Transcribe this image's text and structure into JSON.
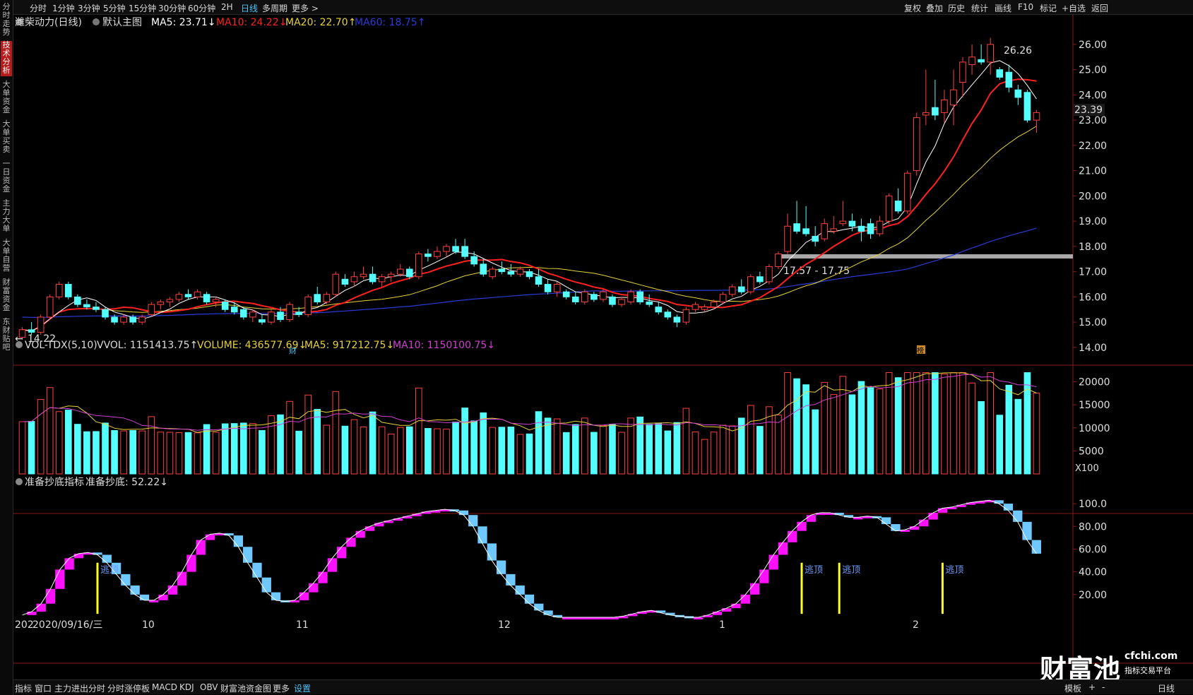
{
  "topbar": {
    "left_tabs": [
      "分时",
      "1分钟",
      "3分钟",
      "5分钟",
      "15分钟",
      "30分钟",
      "60分钟",
      "2H",
      "日线",
      "多周期",
      "更多 >"
    ],
    "active_tab": "日线",
    "right_items": [
      "复权",
      "叠加",
      "历史",
      "统计",
      "画线",
      "F10",
      "标记",
      "+自选",
      "返回"
    ]
  },
  "sidebar": {
    "items": [
      "分时走势",
      "技术分析",
      "大单资金",
      "大单买卖",
      "一日资金",
      "主力大单",
      "大单自营",
      "财富资金",
      "东财贴吧"
    ],
    "active": "技术分析"
  },
  "header": {
    "stock": "潍柴动力(日线)",
    "template": "默认主图",
    "ma5": "MA5: 23.71↓",
    "ma10": "MA10: 24.22↓",
    "ma20": "MA20: 22.70↑",
    "ma60": "MA60: 18.75↑",
    "colors": {
      "ma5": "#ffffff",
      "ma10": "#ff2020",
      "ma20": "#e6d23a",
      "ma60": "#2b3bd9"
    }
  },
  "price_panel": {
    "y_ticks": [
      "26.00",
      "25.00",
      "24.00",
      "23.00",
      "22.00",
      "21.00",
      "20.00",
      "19.00",
      "18.00",
      "17.00",
      "16.00",
      "15.00",
      "14.00"
    ],
    "high_label": "26.26",
    "low_label": "14.22",
    "current_label": "23.39",
    "zone_label": "17.57 - 17.75",
    "markers": [
      "财",
      "榜"
    ]
  },
  "volume_panel": {
    "header": {
      "name": "VOL-TDX(5,10)",
      "vvol": "VVOL: 1151413.75↑",
      "volume": "VOLUME: 436577.69↓",
      "ma5": "MA5: 917212.75↓",
      "ma10": "MA10: 1150100.75↓"
    },
    "y_ticks": [
      "20000",
      "15000",
      "10000",
      "5000"
    ],
    "unit": "X100"
  },
  "indicator_panel": {
    "header": {
      "name": "准备抄底指标",
      "value": "准备抄底: 52.22↓"
    },
    "y_ticks": [
      "100.0",
      "80.00",
      "60.00",
      "40.00",
      "20.00"
    ],
    "signal_label": "逃顶"
  },
  "x_axis": {
    "first_date": "2020/09/16/三",
    "first_prefix": "202",
    "months": [
      "10",
      "11",
      "12",
      "1",
      "2"
    ]
  },
  "bottombar": {
    "tabs": [
      "指标",
      "窗口",
      "主力进出分时",
      "分时涨停板",
      "MACD",
      "KDJ",
      "OBV",
      "财富池资金图",
      "更多",
      "设置"
    ],
    "active": "设置",
    "right_items": [
      "模板",
      "+",
      "-",
      "日线"
    ]
  },
  "watermark": {
    "brand": "财富池",
    "site": "cfchi.com",
    "slogan": "指标交易平台"
  },
  "chart_data": {
    "type": "candlestick",
    "y_range": [
      13.8,
      26.5
    ],
    "n_candles": 100,
    "ohlc": [
      [
        14.4,
        14.8,
        14.3,
        14.7
      ],
      [
        14.7,
        15.0,
        14.5,
        14.6
      ],
      [
        14.6,
        15.3,
        14.5,
        15.2
      ],
      [
        15.2,
        16.1,
        15.1,
        16.0
      ],
      [
        16.0,
        16.6,
        15.9,
        16.5
      ],
      [
        16.5,
        16.6,
        15.9,
        16.0
      ],
      [
        16.0,
        16.1,
        15.6,
        15.7
      ],
      [
        15.7,
        15.9,
        15.5,
        15.6
      ],
      [
        15.6,
        15.8,
        15.4,
        15.5
      ],
      [
        15.5,
        15.6,
        15.1,
        15.2
      ],
      [
        15.2,
        15.3,
        14.9,
        15.0
      ],
      [
        15.0,
        15.3,
        14.9,
        15.2
      ],
      [
        15.2,
        15.3,
        14.9,
        15.0
      ],
      [
        15.0,
        15.3,
        14.9,
        15.2
      ],
      [
        15.3,
        15.8,
        15.2,
        15.7
      ],
      [
        15.7,
        15.9,
        15.5,
        15.8
      ],
      [
        15.8,
        16.0,
        15.6,
        15.9
      ],
      [
        15.9,
        16.2,
        15.8,
        16.1
      ],
      [
        16.1,
        16.3,
        15.9,
        16.0
      ],
      [
        16.0,
        16.3,
        15.9,
        16.2
      ],
      [
        16.1,
        16.2,
        15.7,
        15.8
      ],
      [
        15.8,
        16.0,
        15.6,
        15.9
      ],
      [
        15.8,
        15.9,
        15.4,
        15.5
      ],
      [
        15.6,
        15.8,
        15.3,
        15.4
      ],
      [
        15.5,
        15.6,
        15.1,
        15.2
      ],
      [
        15.2,
        15.5,
        15.0,
        15.4
      ],
      [
        15.1,
        15.3,
        14.9,
        15.0
      ],
      [
        15.0,
        15.5,
        14.9,
        15.4
      ],
      [
        15.4,
        15.6,
        15.0,
        15.1
      ],
      [
        15.1,
        15.8,
        15.0,
        15.7
      ],
      [
        15.4,
        15.6,
        15.2,
        15.3
      ],
      [
        15.3,
        16.1,
        15.2,
        16.0
      ],
      [
        16.1,
        16.4,
        15.7,
        15.8
      ],
      [
        15.8,
        16.2,
        15.7,
        16.1
      ],
      [
        16.1,
        17.0,
        16.0,
        16.9
      ],
      [
        16.7,
        16.9,
        16.4,
        16.5
      ],
      [
        16.6,
        17.0,
        16.4,
        16.8
      ],
      [
        16.8,
        17.2,
        16.7,
        16.9
      ],
      [
        16.9,
        17.2,
        16.5,
        16.6
      ],
      [
        16.6,
        16.9,
        16.4,
        16.8
      ],
      [
        16.8,
        17.0,
        16.6,
        16.9
      ],
      [
        16.9,
        17.3,
        16.8,
        17.1
      ],
      [
        17.1,
        17.2,
        16.7,
        16.8
      ],
      [
        16.8,
        17.8,
        16.7,
        17.7
      ],
      [
        17.7,
        17.9,
        17.4,
        17.6
      ],
      [
        17.6,
        18.0,
        17.5,
        17.8
      ],
      [
        17.8,
        18.1,
        17.6,
        18.0
      ],
      [
        18.0,
        18.3,
        17.7,
        17.8
      ],
      [
        18.0,
        18.3,
        17.5,
        17.6
      ],
      [
        17.6,
        17.8,
        17.2,
        17.3
      ],
      [
        17.3,
        17.5,
        16.8,
        16.9
      ],
      [
        16.8,
        17.2,
        16.7,
        17.1
      ],
      [
        17.1,
        17.4,
        16.9,
        17.0
      ],
      [
        17.0,
        17.3,
        16.8,
        16.9
      ],
      [
        16.9,
        17.2,
        16.8,
        17.1
      ],
      [
        17.0,
        17.1,
        16.7,
        16.8
      ],
      [
        16.8,
        17.1,
        16.4,
        16.5
      ],
      [
        16.5,
        16.7,
        16.1,
        16.2
      ],
      [
        16.2,
        16.6,
        16.0,
        16.5
      ],
      [
        16.2,
        16.3,
        15.9,
        16.0
      ],
      [
        16.0,
        16.2,
        15.7,
        15.8
      ],
      [
        15.8,
        16.3,
        15.7,
        16.2
      ],
      [
        16.1,
        16.2,
        15.8,
        15.9
      ],
      [
        15.9,
        16.3,
        15.8,
        16.2
      ],
      [
        16.0,
        16.1,
        15.6,
        15.7
      ],
      [
        15.7,
        16.0,
        15.6,
        15.9
      ],
      [
        15.8,
        16.3,
        15.7,
        16.2
      ],
      [
        16.2,
        16.3,
        15.7,
        15.8
      ],
      [
        15.8,
        16.1,
        15.6,
        15.7
      ],
      [
        15.6,
        15.8,
        15.3,
        15.4
      ],
      [
        15.4,
        15.5,
        15.1,
        15.2
      ],
      [
        15.2,
        15.3,
        14.8,
        15.0
      ],
      [
        15.0,
        15.6,
        14.9,
        15.5
      ],
      [
        15.5,
        15.8,
        15.4,
        15.7
      ],
      [
        15.5,
        15.7,
        15.4,
        15.6
      ],
      [
        15.6,
        15.9,
        15.5,
        15.8
      ],
      [
        15.8,
        16.2,
        15.7,
        16.1
      ],
      [
        16.1,
        16.5,
        16.0,
        16.4
      ],
      [
        16.4,
        16.7,
        16.1,
        16.2
      ],
      [
        16.2,
        16.9,
        16.1,
        16.8
      ],
      [
        16.8,
        17.0,
        16.5,
        16.6
      ],
      [
        16.6,
        17.3,
        16.5,
        17.2
      ],
      [
        17.2,
        17.8,
        17.1,
        17.7
      ],
      [
        17.8,
        19.3,
        17.7,
        18.8
      ],
      [
        18.9,
        19.8,
        18.5,
        18.6
      ],
      [
        18.7,
        19.6,
        18.4,
        18.5
      ],
      [
        18.4,
        18.8,
        18.0,
        18.2
      ],
      [
        18.3,
        19.1,
        18.2,
        18.9
      ],
      [
        18.6,
        19.2,
        18.5,
        18.7
      ],
      [
        18.9,
        19.8,
        18.8,
        19.0
      ],
      [
        19.0,
        19.3,
        18.6,
        18.8
      ],
      [
        18.8,
        19.1,
        18.2,
        18.6
      ],
      [
        18.9,
        19.1,
        18.3,
        18.5
      ],
      [
        18.5,
        19.2,
        18.4,
        19.0
      ],
      [
        19.0,
        20.1,
        18.9,
        20.0
      ],
      [
        19.8,
        20.3,
        19.3,
        19.4
      ],
      [
        19.4,
        21.0,
        19.3,
        20.9
      ],
      [
        21.0,
        23.3,
        20.8,
        23.1
      ],
      [
        23.2,
        25.0,
        22.8,
        23.3
      ]
    ],
    "ohlc_tail": [
      [
        23.5,
        24.6,
        23.0,
        23.2
      ],
      [
        23.3,
        24.2,
        22.9,
        23.8
      ],
      [
        23.6,
        25.0,
        22.8,
        24.2
      ],
      [
        24.5,
        25.5,
        23.9,
        25.3
      ],
      [
        25.2,
        26.0,
        24.8,
        25.5
      ],
      [
        25.4,
        26.0,
        25.2,
        25.3
      ],
      [
        25.3,
        26.26,
        24.8,
        26.0
      ],
      [
        25.0,
        25.1,
        24.6,
        24.7
      ],
      [
        24.9,
        25.2,
        24.1,
        24.3
      ],
      [
        24.2,
        24.4,
        23.6,
        23.9
      ],
      [
        24.1,
        24.2,
        22.9,
        23.0
      ],
      [
        23.0,
        23.4,
        22.5,
        23.3
      ]
    ],
    "ma_series": [
      "MA5",
      "MA10",
      "MA20",
      "MA60"
    ],
    "volume_y_range": [
      0,
      23000
    ],
    "indicator_y_range": [
      0,
      110
    ],
    "indicator": [
      2,
      5,
      12,
      25,
      42,
      52,
      56,
      57,
      55,
      48,
      38,
      28,
      20,
      15,
      15,
      20,
      28,
      40,
      55,
      68,
      73,
      74,
      72,
      62,
      48,
      35,
      22,
      15,
      14,
      15,
      22,
      30,
      40,
      52,
      62,
      70,
      76,
      80,
      83,
      85,
      87,
      89,
      91,
      93,
      94,
      95,
      94,
      90,
      80,
      65,
      50,
      38,
      28,
      20,
      12,
      6,
      2,
      0,
      0,
      0,
      0,
      0,
      0,
      0,
      1,
      3,
      5,
      6,
      4,
      2,
      1,
      0,
      0,
      2,
      5,
      8,
      12,
      20,
      30,
      42,
      55,
      66,
      76,
      84,
      90,
      92,
      92,
      90,
      88,
      88,
      89,
      88,
      82,
      76,
      77,
      80,
      86,
      92,
      96,
      97,
      99,
      101,
      102,
      103,
      100,
      94,
      84,
      68,
      56
    ],
    "signals_at": [
      83,
      87,
      98
    ]
  }
}
